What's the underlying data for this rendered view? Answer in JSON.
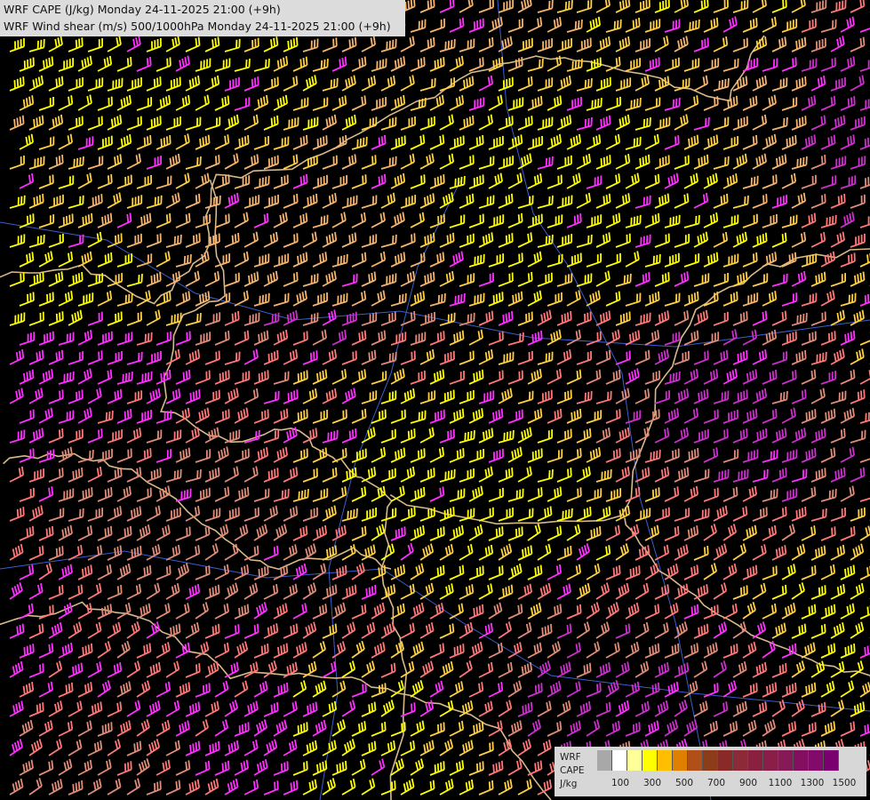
{
  "titles": {
    "line1": "WRF CAPE (J/kg) Monday 24-11-2025 21:00 (+9h)",
    "line2": "WRF Wind shear (m/s) 500/1000hPa Monday 24-11-2025 21:00 (+9h)"
  },
  "legend": {
    "line1": "WRF",
    "line2": "CAPE",
    "line3": "J/kg",
    "ticks": [
      "100",
      "300",
      "500",
      "700",
      "900",
      "1100",
      "1300",
      "1500"
    ],
    "swatches": [
      "#a8a8a8",
      "#ffffff",
      "#ffff99",
      "#ffff00",
      "#ffbf00",
      "#e08000",
      "#b05018",
      "#8c3c18",
      "#8a2a28",
      "#8c2a38",
      "#8a2040",
      "#8a1e48",
      "#861a56",
      "#840e60",
      "#820a6a",
      "#7a0070"
    ]
  },
  "barb_colors": [
    "#ffff00",
    "#ffd040",
    "#f5b46e",
    "#e08c78",
    "#ff7878",
    "#ff30ff",
    "#cc30cc"
  ],
  "border_color": "#d8b98a",
  "river_color": "#3a5fd0"
}
